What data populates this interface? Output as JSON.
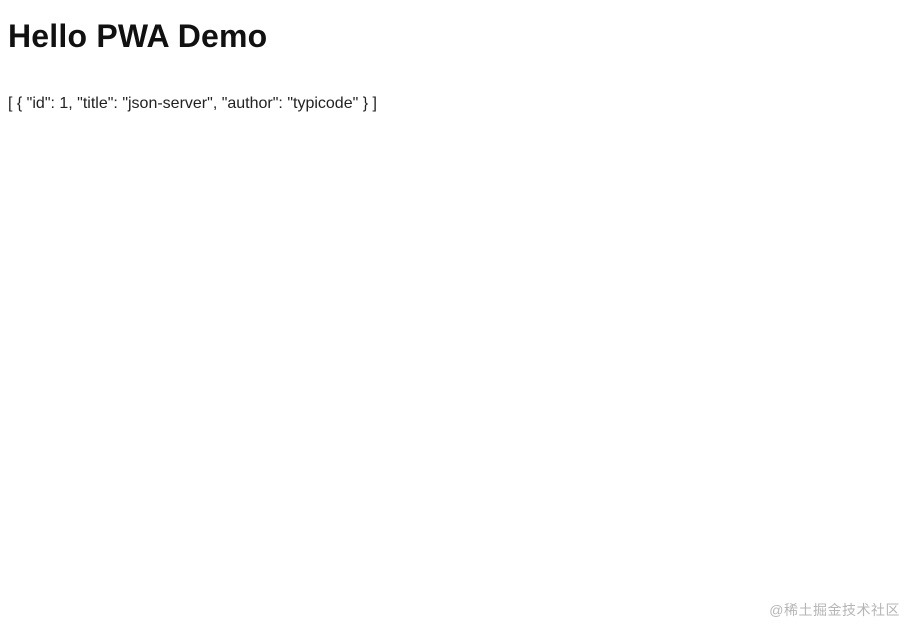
{
  "header": {
    "title": "Hello PWA Demo"
  },
  "main": {
    "json_text": "[ { \"id\": 1, \"title\": \"json-server\", \"author\": \"typicode\" } ]"
  },
  "footer": {
    "watermark": "@稀土掘金技术社区"
  }
}
